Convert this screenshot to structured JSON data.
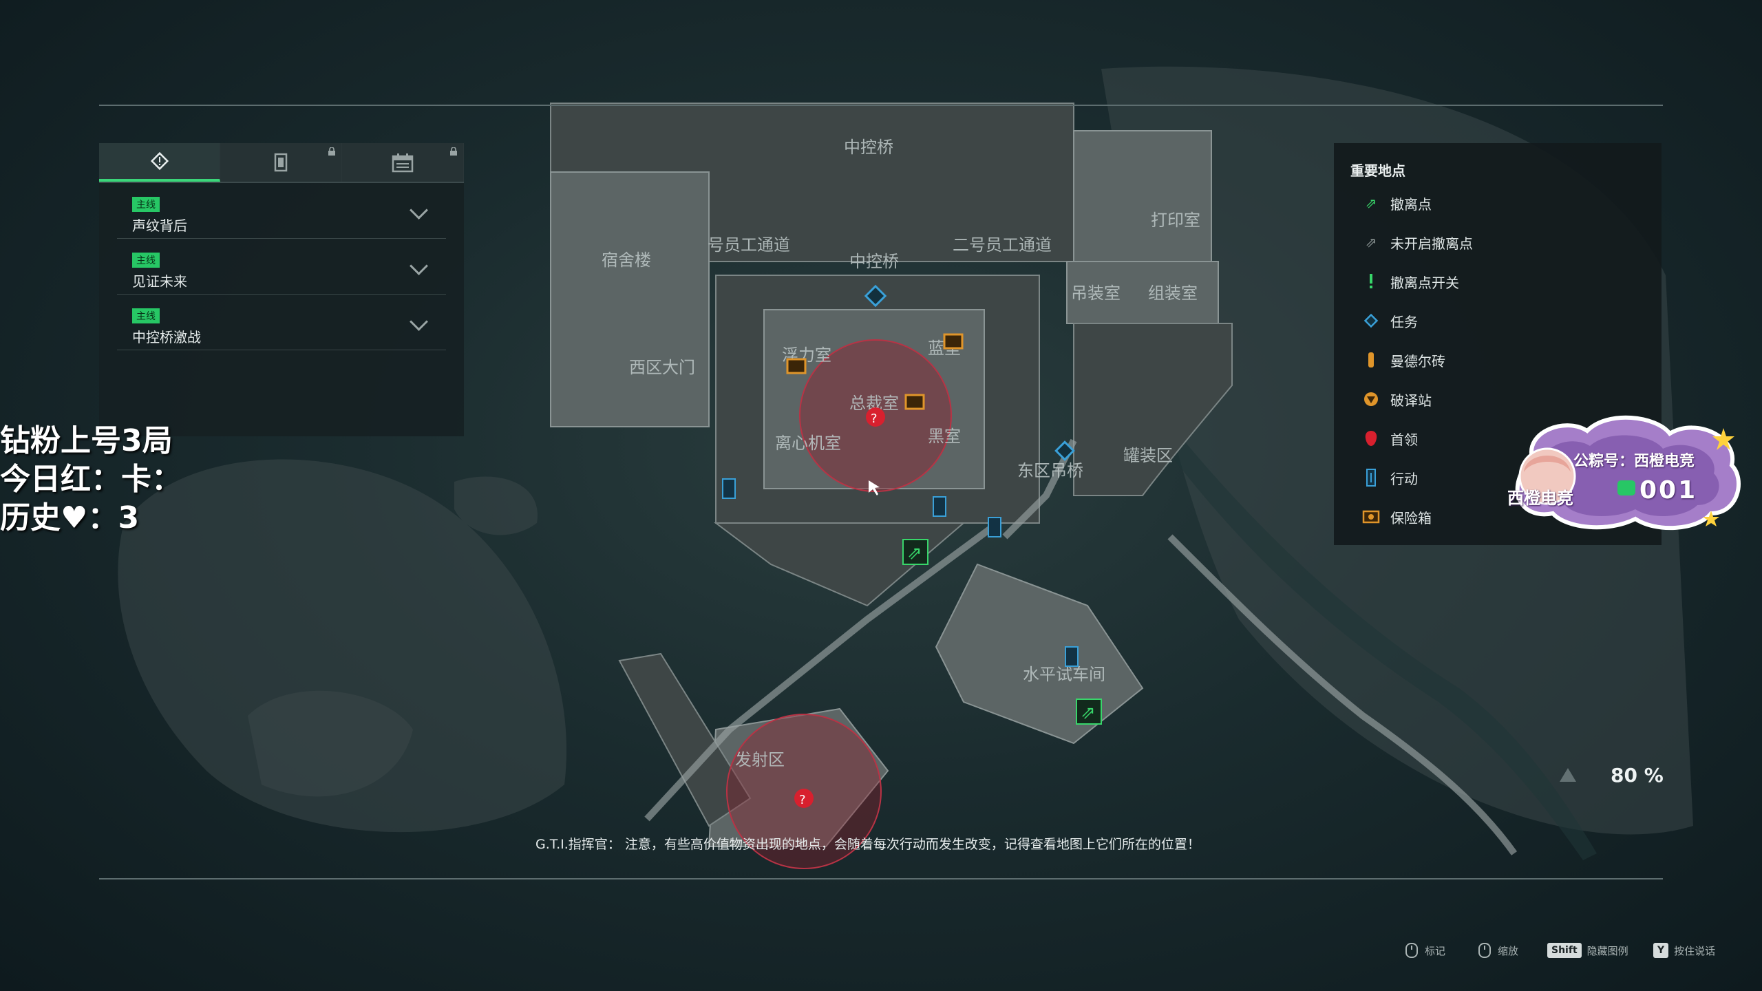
{
  "map": {
    "labels": {
      "zhongkongqiao_top": "中控桥",
      "dorm": "宿舍楼",
      "worker_a": "号员工通道",
      "worker_b": "二号员工通道",
      "zhongkongqiao": "中控桥",
      "print": "打印室",
      "hoist": "吊装室",
      "assemble": "组装室",
      "west_gate": "西区大门",
      "power": "浮力室",
      "blue": "蓝室",
      "boss_room": "总裁室",
      "centrifuge": "离心机室",
      "black": "黑室",
      "east_bridge": "东区吊桥",
      "tank": "罐装区",
      "hdrive": "水平试车间",
      "launch": "发射区"
    },
    "colors": {
      "hotzone": "#8e1f2e",
      "exit": "#38d66a",
      "task": "#3aa0d8",
      "safe": "#e0952a"
    }
  },
  "quest_panel": {
    "tabs": [
      {
        "icon": "diamond-icon",
        "locked": false
      },
      {
        "icon": "card-icon",
        "locked": true
      },
      {
        "icon": "calendar-icon",
        "locked": true
      }
    ],
    "items": [
      {
        "badge": "主线",
        "name": "声纹背后"
      },
      {
        "badge": "主线",
        "name": "见证未来"
      },
      {
        "badge": "主线",
        "name": "中控桥激战"
      }
    ]
  },
  "stream_overlay": {
    "line1": "钻粉上号3局",
    "line2": "今日红：卡：",
    "line3": "历史♥：3"
  },
  "legend": {
    "title": "重要地点",
    "items": [
      {
        "icon": "running-exit-icon",
        "label": "撤离点",
        "color": "#38d66a"
      },
      {
        "icon": "inactive-exit-icon",
        "label": "未开启撤离点",
        "color": "#8a9393"
      },
      {
        "icon": "exit-switch-icon",
        "label": "撤离点开关",
        "color": "#38d66a"
      },
      {
        "icon": "task-diamond-icon",
        "label": "任务",
        "color": "#3aa0d8"
      },
      {
        "icon": "mandel-brick-icon",
        "label": "曼德尔砖",
        "color": "#e0952a"
      },
      {
        "icon": "decoder-icon",
        "label": "破译站",
        "color": "#e0952a"
      },
      {
        "icon": "boss-icon",
        "label": "首领",
        "color": "#d8202e"
      },
      {
        "icon": "action-icon",
        "label": "行动",
        "color": "#3aa0d8"
      },
      {
        "icon": "safe-icon",
        "label": "保险箱",
        "color": "#e0952a"
      }
    ]
  },
  "badge": {
    "line1": "公粽号：西橙电竞",
    "line2": "西橙电竞",
    "number": "001"
  },
  "zoom": {
    "value": "80 %"
  },
  "dialogue": {
    "text": "G.T.I.指挥官： 注意，有些高价值物资出现的地点，会随着每次行动而发生改变，记得查看地图上它们所在的位置！"
  },
  "controls": [
    {
      "key": "",
      "label": "标记"
    },
    {
      "key": "",
      "label": "缩放"
    },
    {
      "key": "Shift",
      "label": "隐藏图例"
    },
    {
      "key": "Y",
      "label": "按住说话"
    }
  ]
}
